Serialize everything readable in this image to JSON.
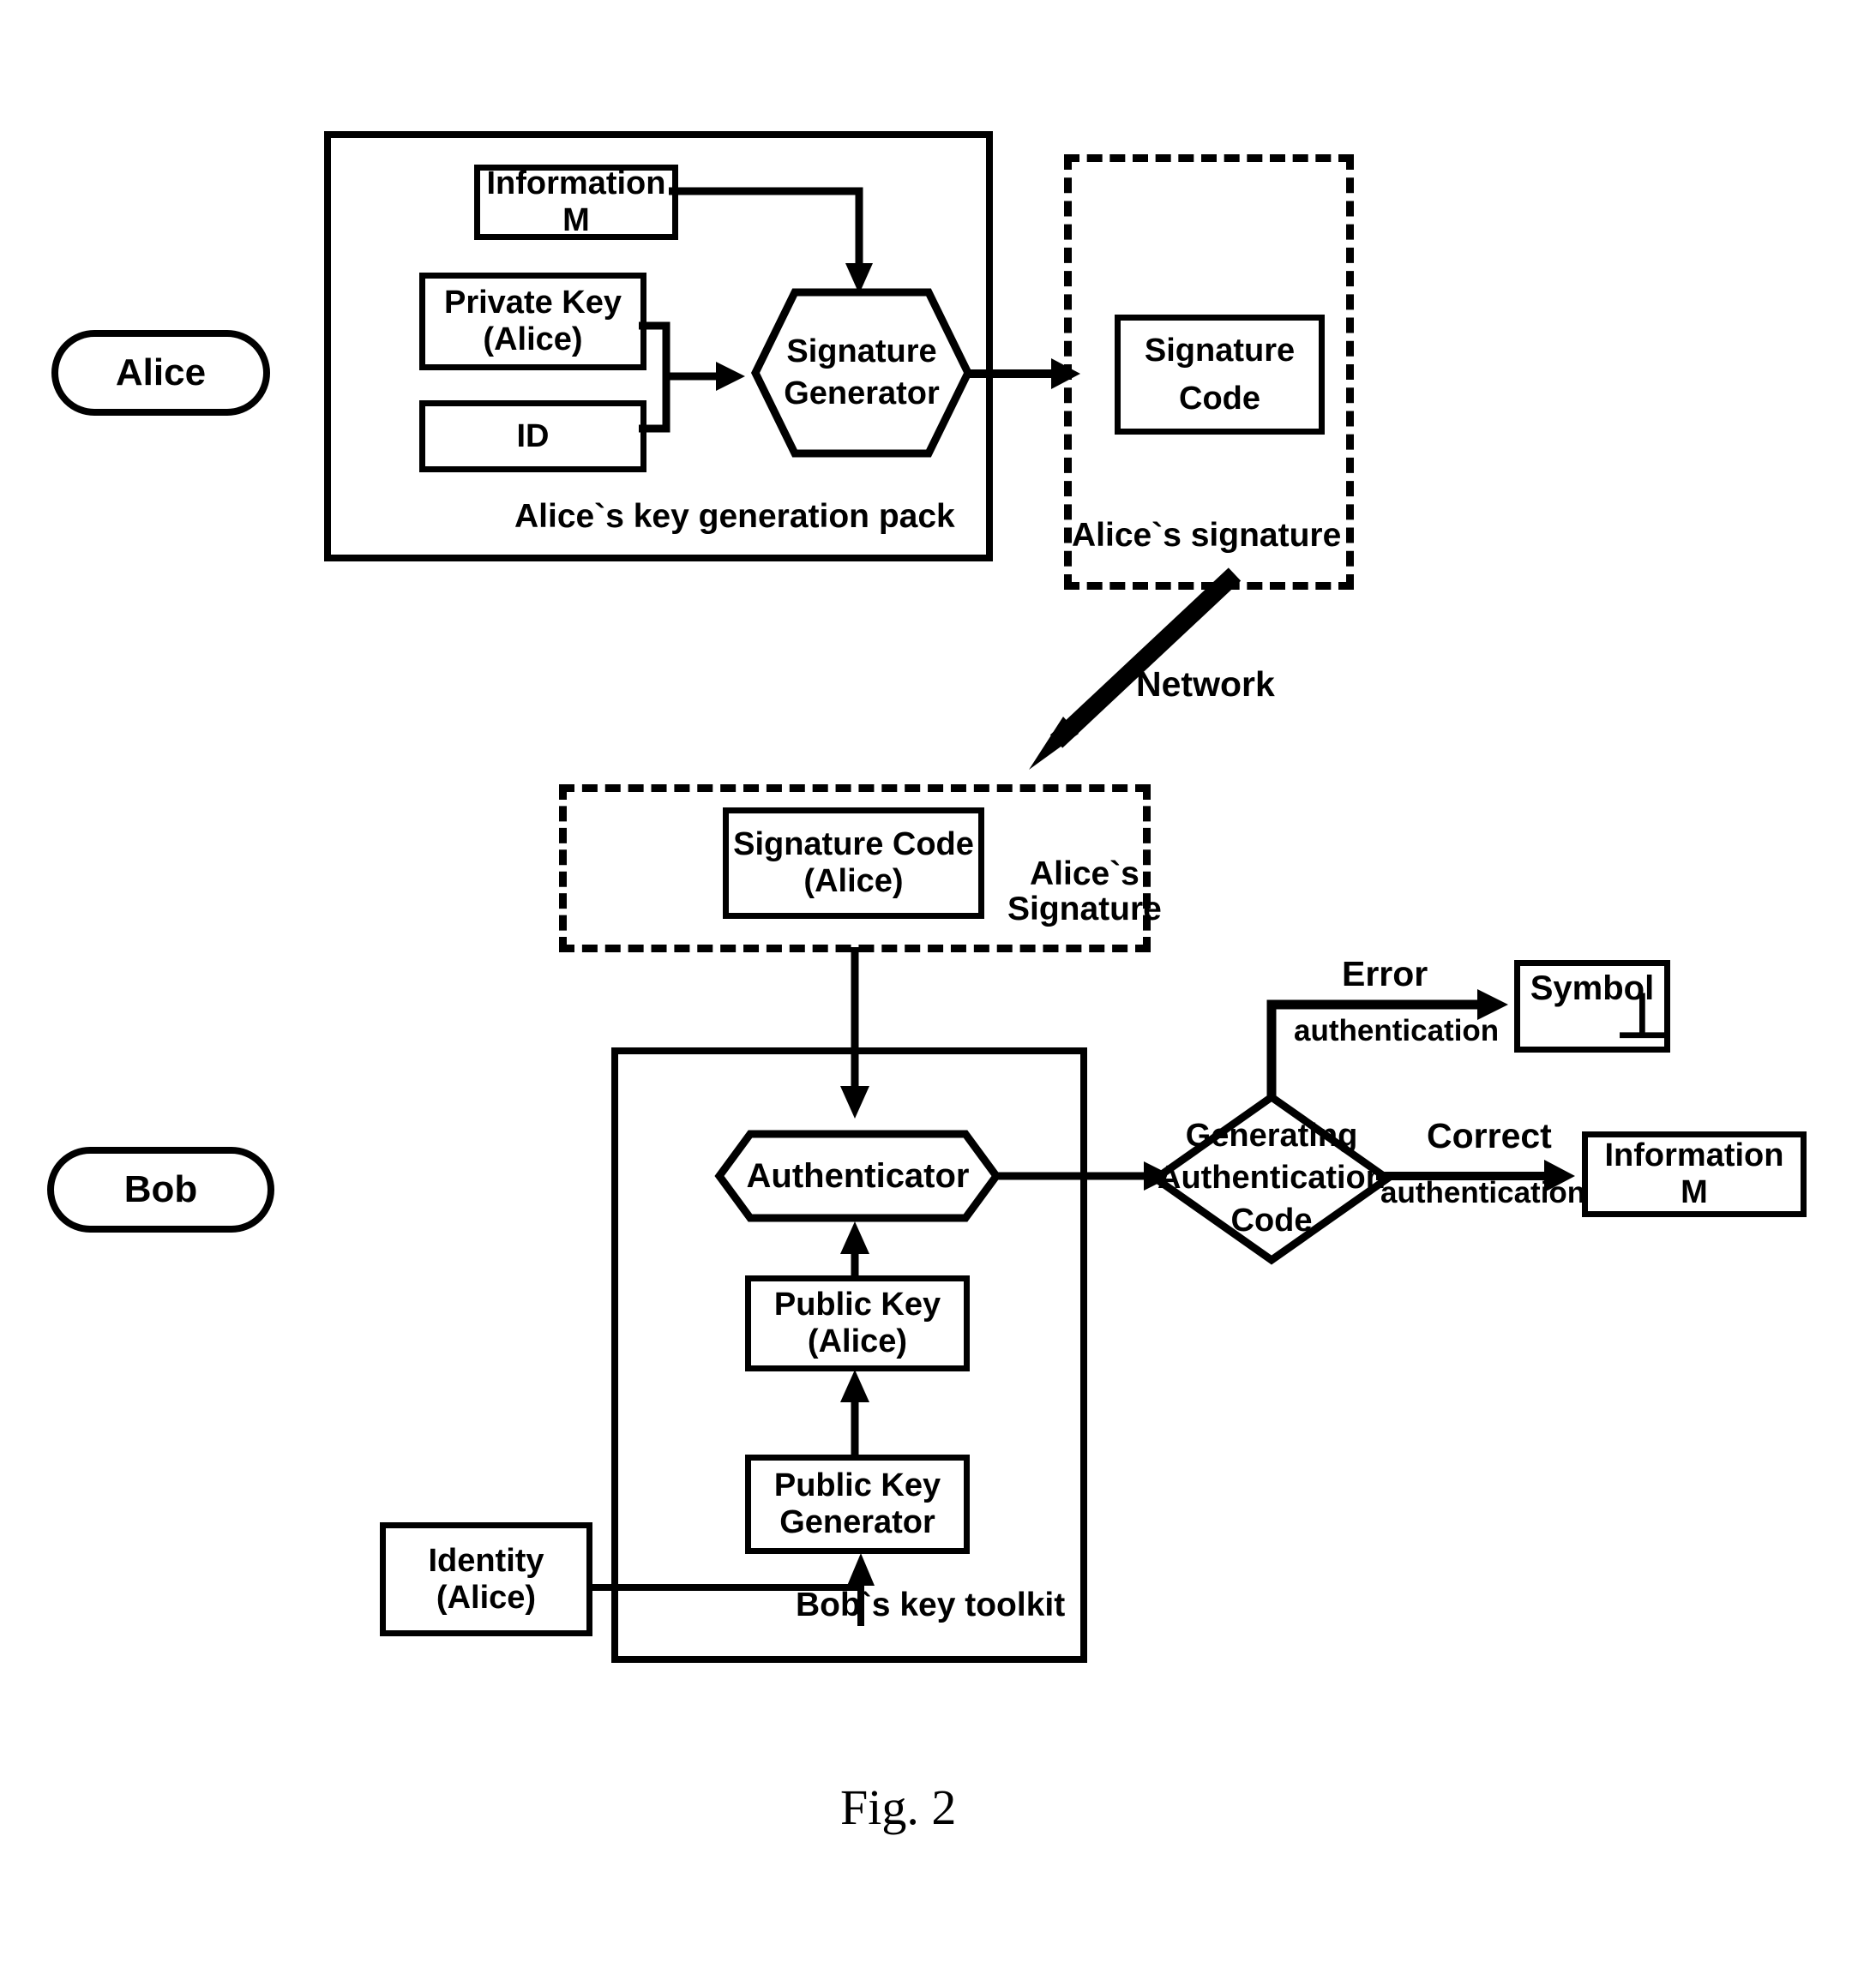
{
  "figure": {
    "caption": "Fig. 2"
  },
  "actors": {
    "alice": "Alice",
    "bob": "Bob"
  },
  "groups": {
    "alice_pack": "Alice`s key generation pack",
    "alice_signature_top": "Alice`s signature",
    "alice_signature_mid_line1": "Alice`s",
    "alice_signature_mid_line2": "Signature",
    "bob_toolkit": "Bob`s key toolkit"
  },
  "alice_section": {
    "information_m_line1": "Information",
    "information_m_line2": "M",
    "private_key_line1": "Private Key",
    "private_key_line2": "(Alice)",
    "id": "ID",
    "signature_generator_line1": "Signature",
    "signature_generator_line2": "Generator",
    "signature_code_line1": "Signature",
    "signature_code_line2": "Code"
  },
  "network": {
    "label": "Network"
  },
  "transit": {
    "signature_code_line1": "Signature Code",
    "signature_code_line2": "(Alice)"
  },
  "bob_section": {
    "authenticator": "Authenticator",
    "public_key_line1": "Public Key",
    "public_key_line2": "(Alice)",
    "public_key_generator_line1": "Public Key",
    "public_key_generator_line2": "Generator",
    "identity_line1": "Identity",
    "identity_line2": "(Alice)",
    "decision_line1": "Generating",
    "decision_line2": "Authentication",
    "decision_line3": "Code",
    "error_branch_line1": "Error",
    "error_branch_line2": "authentication",
    "correct_branch_line1": "Correct",
    "correct_branch_line2": "authentication",
    "symbol_box_label": "Symbol",
    "symbol_box_glyph": "⊥",
    "information_m_line1": "Information",
    "information_m_line2": "M"
  },
  "colors": {
    "stroke": "#000000",
    "background": "#ffffff"
  }
}
